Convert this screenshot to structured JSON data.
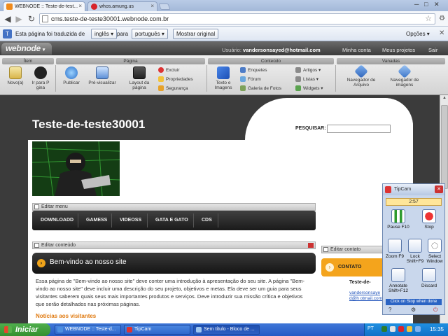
{
  "browser": {
    "tabs": [
      {
        "title": "WEBNODE :: Teste-de-test...",
        "active": true
      },
      {
        "title": "whos.amung.us",
        "active": false
      }
    ],
    "url": "cms.teste-de-teste30001.webnode.com.br",
    "translate_bar": {
      "text_before": "Esta página foi traduzida de",
      "from_lang": "inglês",
      "text_middle": "para",
      "to_lang": "português",
      "show_original": "Mostrar original",
      "options": "Opções"
    }
  },
  "webnode": {
    "logo": "webnode",
    "user_label": "Usuário:",
    "user_email": "vandersonsayed@hotmail.com",
    "links": [
      "Minha conta",
      "Meus projetos",
      "Sair"
    ],
    "groups": {
      "item": "Ítem",
      "page": "Página",
      "content": "Conteúdo",
      "advanced": "Vanadas"
    },
    "buttons": {
      "new": "Novo(a)",
      "goto": "Ir para P gina",
      "publish": "Publicar",
      "preview": "Pré-visualizar",
      "layout": "Layout da página",
      "delete": "Excluir",
      "properties": "Propriedades",
      "security": "Segurança",
      "text_images": "Texto e Imagens",
      "polls": "Enquetes",
      "forum": "Fórum",
      "gallery": "Galeria de Fotos",
      "articles": "Artigos",
      "lists": "Listas",
      "widgets": "Widgets",
      "file_browser": "Navegador de Arquivo",
      "image_browser": "Navegador de imagens"
    }
  },
  "site": {
    "title": "Teste-de-teste30001",
    "search_label": "PESQUISAR:",
    "edit_menu": "Editar menu",
    "menu": [
      "DOWNLOADD",
      "GAMESS",
      "VIDEOSS",
      "GATA E GATO",
      "CDS"
    ],
    "edit_content": "Editar conteúdo",
    "section_title": "Bem-vindo ao nosso site",
    "body": "Essa página de \"Bem-vindo ao nosso site\" deve conter uma introdução à apresentação do seu site. A página \"Bem-vindo ao nosso site\" deve incluir uma descrição do seu projeto, objetivos e metas. Ela deve ser um guia para seus visitantes saberem quais seus mais importantes produtos e serviços. Deve introduzir sua missão crítica e objetivos que serão detalhados nas próximas páginas.",
    "news_link": "Notícias aos visitantes",
    "edit_contact": "Editar contato",
    "contact_title": "CONTATO",
    "contact_name": "Teste-de-",
    "contact_email": "vandersonsaye d@h otmail.com"
  },
  "tipcam": {
    "title": "TipCam",
    "timer": "2:57",
    "buttons": [
      {
        "label": "Pause F10",
        "icon": "pause-icon"
      },
      {
        "label": "Stop",
        "icon": "stop-icon"
      },
      {
        "label": "Zoom F9",
        "icon": "zoom-icon"
      },
      {
        "label": "Lock Shift+F9",
        "icon": "lock-icon"
      },
      {
        "label": "Select Window",
        "icon": "crosshair-icon"
      },
      {
        "label": "Annotate Shift+F12",
        "icon": "annotate-icon"
      },
      {
        "label": "Discard",
        "icon": "trash-icon"
      }
    ],
    "hint": "Click on Stop when done"
  },
  "taskbar": {
    "start": "Iniciar",
    "tasks": [
      "WEBNODE :: Teste-d...",
      "TipCam",
      "Sem título - Bloco de ..."
    ],
    "lang": "PT",
    "clock": "15:35"
  }
}
